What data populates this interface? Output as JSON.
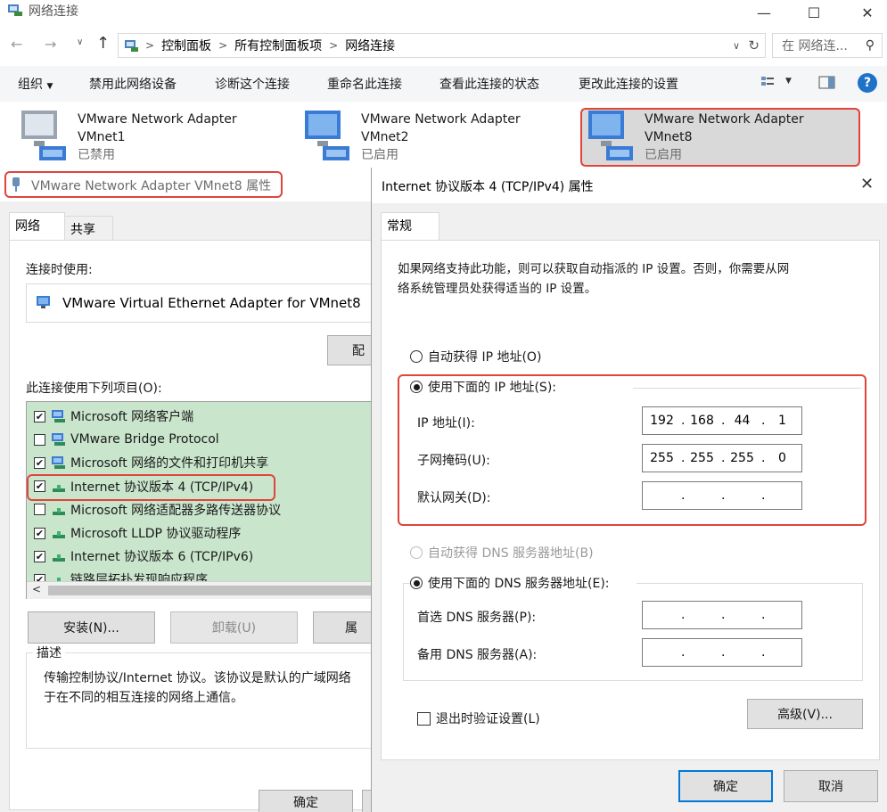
{
  "explorer": {
    "title": "网络连接",
    "breadcrumb": [
      "控制面板",
      "所有控制面板项",
      "网络连接"
    ],
    "search_placeholder": "在 网络连...",
    "commands": [
      "组织",
      "禁用此网络设备",
      "诊断这个连接",
      "重命名此连接",
      "查看此连接的状态",
      "更改此连接的设置"
    ],
    "adapters": [
      {
        "name": "VMware Network Adapter",
        "sub": "VMnet1",
        "status": "已禁用"
      },
      {
        "name": "VMware Network Adapter",
        "sub": "VMnet2",
        "status": "已启用"
      },
      {
        "name": "VMware Network Adapter",
        "sub": "VMnet8",
        "status": "已启用"
      }
    ]
  },
  "adapter_dialog": {
    "title": "VMware Network Adapter VMnet8 属性",
    "tabs": [
      "网络",
      "共享"
    ],
    "connect_using_label": "连接时使用:",
    "adapter_name": "VMware Virtual Ethernet Adapter for VMnet8",
    "configure_button": "配",
    "items_label": "此连接使用下列项目(O):",
    "items": [
      {
        "label": "Microsoft 网络客户端",
        "checked": true
      },
      {
        "label": "VMware Bridge Protocol",
        "checked": false
      },
      {
        "label": "Microsoft 网络的文件和打印机共享",
        "checked": true
      },
      {
        "label": "Internet 协议版本 4 (TCP/IPv4)",
        "checked": true
      },
      {
        "label": "Microsoft 网络适配器多路传送器协议",
        "checked": false
      },
      {
        "label": "Microsoft LLDP 协议驱动程序",
        "checked": true
      },
      {
        "label": "Internet 协议版本 6 (TCP/IPv6)",
        "checked": true
      },
      {
        "label": "链路层拓扑发现响应程序",
        "checked": true
      }
    ],
    "install_button": "安装(N)...",
    "uninstall_button": "卸载(U)",
    "properties_button": "属",
    "description_title": "描述",
    "description_text_1": "传输控制协议/Internet 协议。该协议是默认的广域网络",
    "description_text_2": "于在不同的相互连接的网络上通信。",
    "ok_button": "确定"
  },
  "ipv4_dialog": {
    "title": "Internet 协议版本 4 (TCP/IPv4) 属性",
    "tab": "常规",
    "intro_line1": "如果网络支持此功能，则可以获取自动指派的 IP 设置。否则，你需要从网",
    "intro_line2": "络系统管理员处获得适当的 IP 设置。",
    "auto_ip": "自动获得 IP 地址(O)",
    "use_ip": "使用下面的 IP 地址(S):",
    "ip_label": "IP 地址(I):",
    "ip": [
      "192",
      "168",
      "44",
      "1"
    ],
    "mask_label": "子网掩码(U):",
    "mask": [
      "255",
      "255",
      "255",
      "0"
    ],
    "gateway_label": "默认网关(D):",
    "gateway": [
      "",
      "",
      "",
      ""
    ],
    "auto_dns": "自动获得 DNS 服务器地址(B)",
    "use_dns": "使用下面的 DNS 服务器地址(E):",
    "dns1_label": "首选 DNS 服务器(P):",
    "dns2_label": "备用 DNS 服务器(A):",
    "validate_label": "退出时验证设置(L)",
    "advanced_button": "高级(V)...",
    "ok_button": "确定",
    "cancel_button": "取消"
  }
}
